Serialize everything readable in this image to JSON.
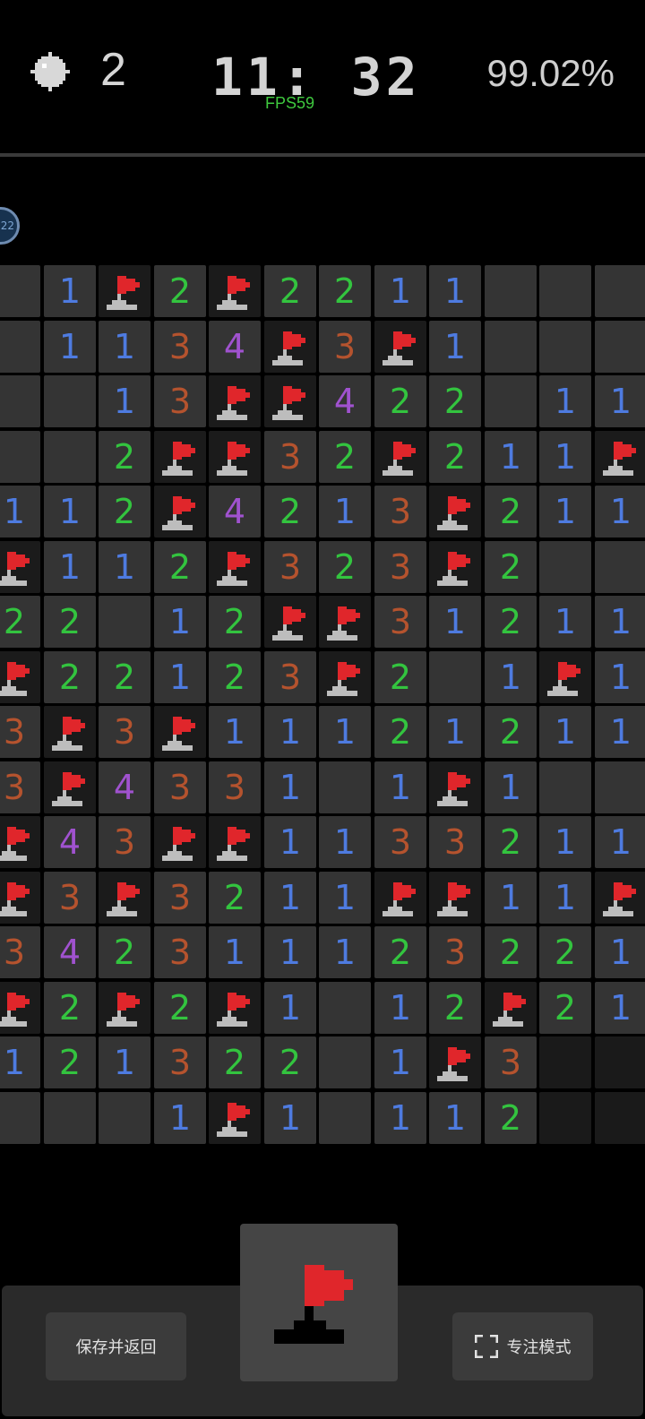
{
  "header": {
    "mine_count": "2",
    "timer": "11: 32",
    "fps": "FPS59",
    "progress_percent": "99.02%"
  },
  "player_badge": "22",
  "board": {
    "rows": [
      [
        "E",
        "1",
        "F",
        "2",
        "F",
        "2",
        "2",
        "1",
        "1",
        "E",
        "E",
        "E"
      ],
      [
        "E",
        "1",
        "1",
        "3",
        "4",
        "F",
        "3",
        "F",
        "1",
        "E",
        "E",
        "E"
      ],
      [
        "E",
        "E",
        "1",
        "3",
        "F",
        "F",
        "4",
        "2",
        "2",
        "E",
        "1",
        "1"
      ],
      [
        "E",
        "E",
        "2",
        "F",
        "F",
        "3",
        "2",
        "F",
        "2",
        "1",
        "1",
        "F"
      ],
      [
        "1",
        "1",
        "2",
        "F",
        "4",
        "2",
        "1",
        "3",
        "F",
        "2",
        "1",
        "1"
      ],
      [
        "F",
        "1",
        "1",
        "2",
        "F",
        "3",
        "2",
        "3",
        "F",
        "2",
        "E",
        "E"
      ],
      [
        "2",
        "2",
        "E",
        "1",
        "2",
        "F",
        "F",
        "3",
        "1",
        "2",
        "1",
        "1"
      ],
      [
        "F",
        "2",
        "2",
        "1",
        "2",
        "3",
        "F",
        "2",
        "E",
        "1",
        "F",
        "1"
      ],
      [
        "3",
        "F",
        "3",
        "F",
        "1",
        "1",
        "1",
        "2",
        "1",
        "2",
        "1",
        "1"
      ],
      [
        "3",
        "F",
        "4",
        "3",
        "3",
        "1",
        "E",
        "1",
        "F",
        "1",
        "E",
        "E"
      ],
      [
        "F",
        "4",
        "3",
        "F",
        "F",
        "1",
        "1",
        "3",
        "3",
        "2",
        "1",
        "1"
      ],
      [
        "F",
        "3",
        "F",
        "3",
        "2",
        "1",
        "1",
        "F",
        "F",
        "1",
        "1",
        "F"
      ],
      [
        "3",
        "4",
        "2",
        "3",
        "1",
        "1",
        "1",
        "2",
        "3",
        "2",
        "2",
        "1"
      ],
      [
        "F",
        "2",
        "F",
        "2",
        "F",
        "1",
        "E",
        "1",
        "2",
        "F",
        "2",
        "1"
      ],
      [
        "1",
        "2",
        "1",
        "3",
        "2",
        "2",
        "E",
        "1",
        "F",
        "3",
        "C",
        "C"
      ],
      [
        "E",
        "E",
        "E",
        "1",
        "F",
        "1",
        "E",
        "1",
        "1",
        "2",
        "C",
        "C"
      ]
    ]
  },
  "colors": {
    "one": "#4e7be0",
    "two": "#33c43f",
    "three": "#b5532e",
    "four": "#a052cf",
    "flag": "#e0262b"
  },
  "bottom": {
    "save_label": "保存并返回",
    "focus_label": "专注模式",
    "mode_icon": "flag-icon"
  }
}
